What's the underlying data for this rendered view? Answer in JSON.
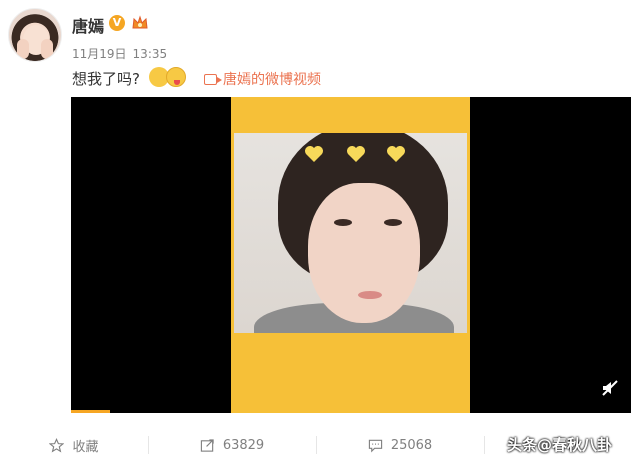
{
  "post": {
    "username": "唐嫣",
    "badge": "V",
    "date": "11月19日",
    "time": "13:35",
    "text": "想我了吗?",
    "video_link": "唐嫣的微博视频"
  },
  "actions": {
    "favorite_label": "收藏",
    "repost_count": "63829",
    "comment_count": "25068"
  },
  "video": {
    "progress_fraction": 0.07,
    "frame_color": "#f6c038"
  },
  "watermark": "头条@春秋八卦",
  "colors": {
    "link": "#eb7350",
    "badge": "#f5a623",
    "muted": "#808080"
  },
  "icons": [
    "star-icon",
    "repost-icon",
    "comment-icon",
    "mute-icon",
    "video-camera-icon",
    "heart-icon"
  ]
}
